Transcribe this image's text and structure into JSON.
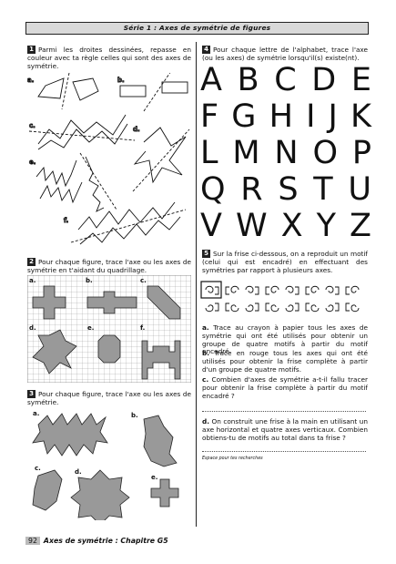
{
  "header": {
    "title": "Série 1 : Axes de symétrie de figures"
  },
  "ex1": {
    "number": "1",
    "text": "Parmi les droites dessinées, repasse en couleur avec ta règle celles qui sont des axes de symétrie.",
    "labels": [
      "a.",
      "b.",
      "c.",
      "d.",
      "e.",
      "f."
    ]
  },
  "ex2": {
    "number": "2",
    "text": "Pour chaque figure, trace l'axe ou les axes de symétrie en t'aidant du quadrillage.",
    "labels": [
      "a.",
      "b.",
      "c.",
      "d.",
      "e.",
      "f."
    ]
  },
  "ex3": {
    "number": "3",
    "text": "Pour chaque figure, trace l'axe ou les axes de symétrie.",
    "labels": [
      "a.",
      "b.",
      "c.",
      "d.",
      "e."
    ]
  },
  "ex4": {
    "number": "4",
    "text": "Pour chaque lettre de l'alphabet, trace l'axe (ou les axes) de symétrie lorsqu'il(s) existe(nt).",
    "rows": [
      [
        "A",
        "B",
        "C",
        "D",
        "E"
      ],
      [
        "F",
        "G",
        "H",
        "I",
        "J",
        "K"
      ],
      [
        "L",
        "M",
        "N",
        "O",
        "P"
      ],
      [
        "Q",
        "R",
        "S",
        "T",
        "U"
      ],
      [
        "V",
        "W",
        "X",
        "Y",
        "Z"
      ]
    ]
  },
  "ex5": {
    "number": "5",
    "text": "Sur la frise ci-dessous, on a reproduit un motif (celui qui est encadré) en effectuant des symétries par rapport à plusieurs axes.",
    "qa_label": "a.",
    "qa": "Trace au crayon à papier tous les axes de symétrie qui ont été utilisés pour obtenir un groupe de quatre motifs à partir du motif encadré.",
    "qb_label": "b.",
    "qb": "Trace en rouge tous les axes qui ont été utilisés pour obtenir la frise complète à partir d'un groupe de quatre motifs.",
    "qc_label": "c.",
    "qc": "Combien d'axes de symétrie a-t-il fallu tracer pour obtenir la frise complète à partir du motif encadré ?",
    "qd_label": "d.",
    "qd": "On construit une frise à la main en utilisant un axe horizontal et quatre axes verticaux. Combien obtiens-tu de motifs au total dans ta frise ?",
    "research": "Espace pour tes recherches"
  },
  "footer": {
    "page": "92",
    "text": "Axes de symétrie : Chapitre G5"
  }
}
